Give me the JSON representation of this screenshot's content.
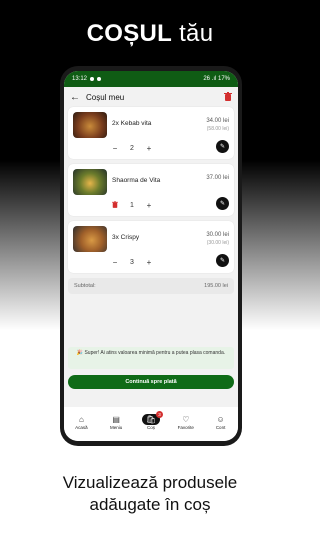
{
  "headline": {
    "bold": "COȘUL",
    "rest": " tău"
  },
  "status": {
    "time": "13:12",
    "right": "26 .ıl 17%"
  },
  "appbar": {
    "back_icon": "arrow-left-icon",
    "title": "Coșul meu",
    "clear_icon": "trash-icon"
  },
  "items": [
    {
      "name": "2x Kebab vita",
      "price": "34.00 lei",
      "old_price": "(58.00 lei)",
      "qty": "2",
      "minus": "−",
      "plus": "+"
    },
    {
      "name": "Shaorma de Vita",
      "price": "37.00 lei",
      "old_price": "",
      "qty": "1",
      "minus": "🗑",
      "plus": "+"
    },
    {
      "name": "3x Crispy",
      "price": "30.00 lei",
      "old_price": "(30.00 lei)",
      "qty": "3",
      "minus": "−",
      "plus": "+"
    }
  ],
  "subtotal": {
    "label": "Subtotal:",
    "value": "195.00 lei"
  },
  "notice": "🎉 Super! Ai atins valoarea minimă pentru a putea plasa comanda.",
  "cta": "Continuă spre plată",
  "nav": [
    {
      "label": "Acasă",
      "icon": "⌂"
    },
    {
      "label": "Meniu",
      "icon": "▤"
    },
    {
      "label": "Coș",
      "icon": "🛍",
      "badge": "3"
    },
    {
      "label": "Favorite",
      "icon": "♡"
    },
    {
      "label": "Cont",
      "icon": "☺"
    }
  ],
  "caption": {
    "line1": "Vizualizează produsele",
    "line2": "adăugate în coș"
  },
  "colors": {
    "brand": "#0f6b17",
    "danger": "#d32f2f"
  }
}
